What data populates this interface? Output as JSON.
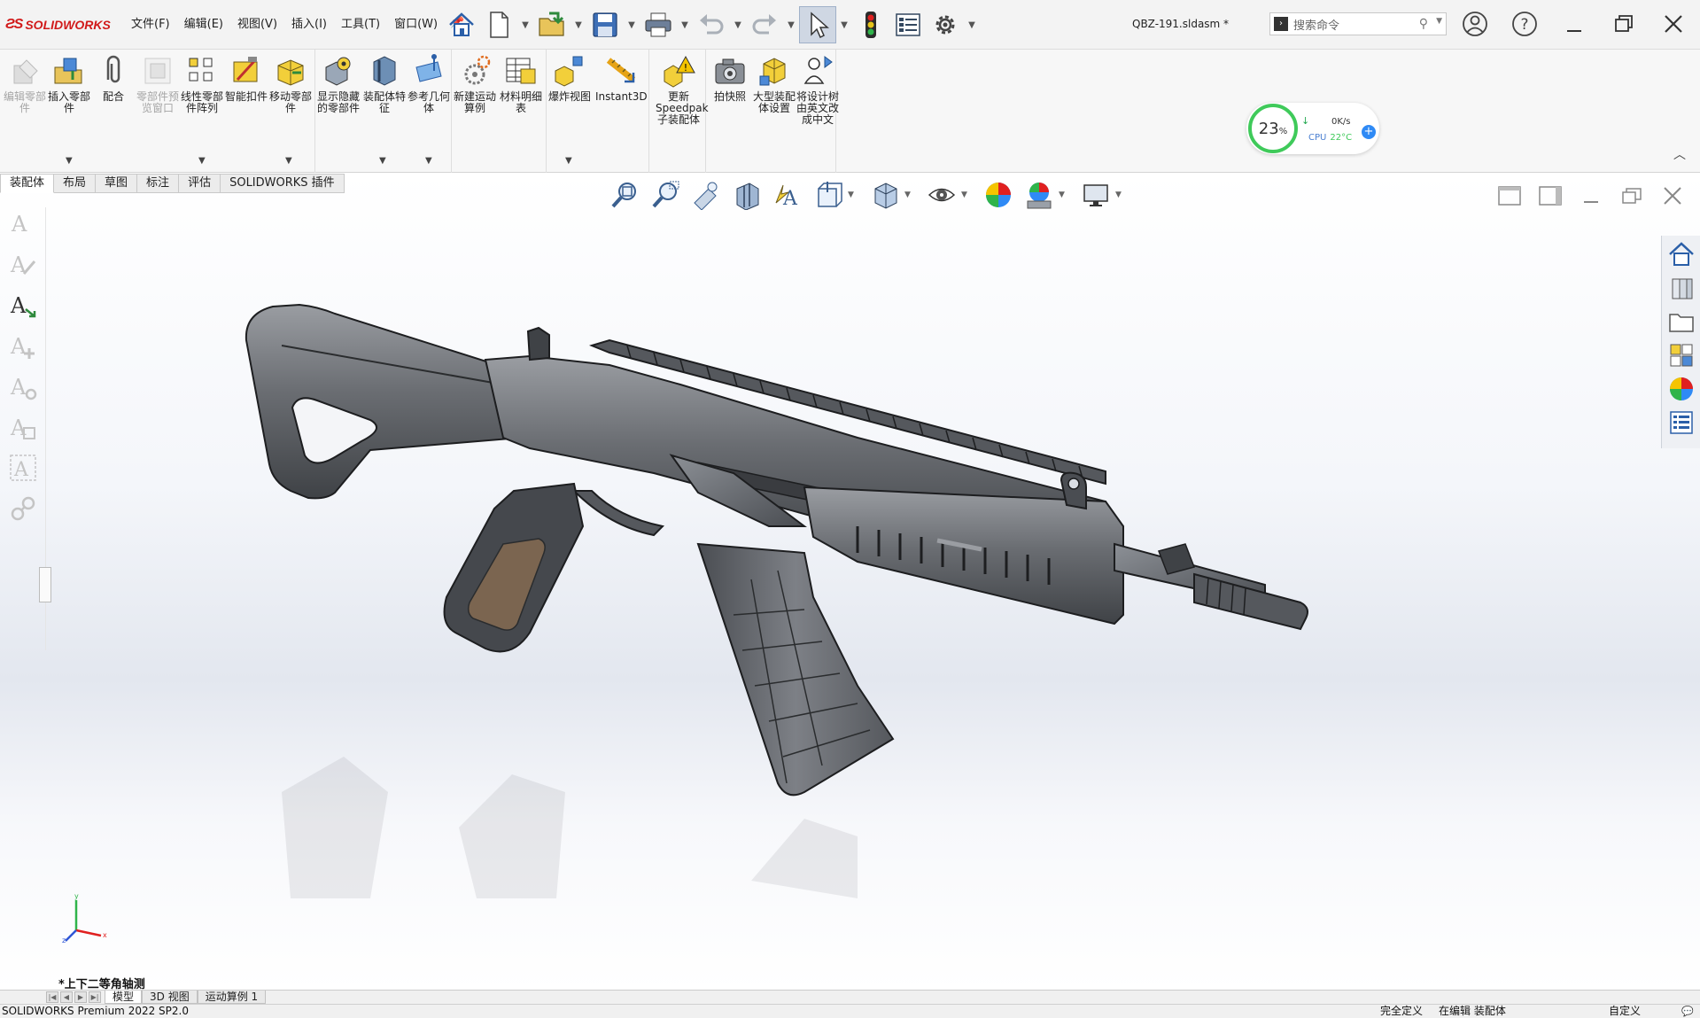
{
  "app": {
    "logo_text": "SOLIDWORKS",
    "document_title": "QBZ-191.sldasm *"
  },
  "menu": {
    "items": [
      "文件(F)",
      "编辑(E)",
      "视图(V)",
      "插入(I)",
      "工具(T)",
      "窗口(W)"
    ]
  },
  "search": {
    "placeholder": "搜索命令"
  },
  "perf_widget": {
    "percent": "23",
    "percent_unit": "%",
    "net": "0K/s",
    "cpu_label": "CPU",
    "cpu_temp": "22°C"
  },
  "ribbon": {
    "buttons": [
      {
        "label": "编辑零部件",
        "disabled": true
      },
      {
        "label": "插入零部件",
        "disabled": false
      },
      {
        "label": "配合",
        "disabled": false
      },
      {
        "label": "零部件预览窗口",
        "disabled": true
      },
      {
        "label": "线性零部件阵列",
        "disabled": false
      },
      {
        "label": "智能扣件",
        "disabled": false
      },
      {
        "label": "移动零部件",
        "disabled": false
      },
      {
        "label": "显示隐藏的零部件",
        "disabled": false
      },
      {
        "label": "装配体特征",
        "disabled": false
      },
      {
        "label": "参考几何体",
        "disabled": false
      },
      {
        "label": "新建运动算例",
        "disabled": false
      },
      {
        "label": "材料明细表",
        "disabled": false
      },
      {
        "label": "爆炸视图",
        "disabled": false
      },
      {
        "label": "Instant3D",
        "disabled": false
      },
      {
        "label": "更新Speedpak子装配体",
        "disabled": false
      },
      {
        "label": "拍快照",
        "disabled": false
      },
      {
        "label": "大型装配体设置",
        "disabled": false
      },
      {
        "label": "将设计树由英文改成中文",
        "disabled": false
      }
    ]
  },
  "command_tabs": [
    "装配体",
    "布局",
    "草图",
    "标注",
    "评估",
    "SOLIDWORKS 插件"
  ],
  "active_command_tab": "装配体",
  "viewport": {
    "view_orientation": "*上下二等角轴测",
    "triad_labels": {
      "x": "x",
      "y": "y",
      "z": "z"
    }
  },
  "bottom_tabs": [
    "模型",
    "3D 视图",
    "运动算例 1"
  ],
  "active_bottom_tab": "模型",
  "status": {
    "product": "SOLIDWORKS Premium 2022 SP2.0",
    "definition": "完全定义",
    "editing": "在编辑 装配体",
    "units": "自定义"
  },
  "colors": {
    "accent_red": "#d11a1a",
    "perf_green": "#3fca5a",
    "grip_brown": "#7b6550",
    "model_grey": "#5f6266"
  }
}
